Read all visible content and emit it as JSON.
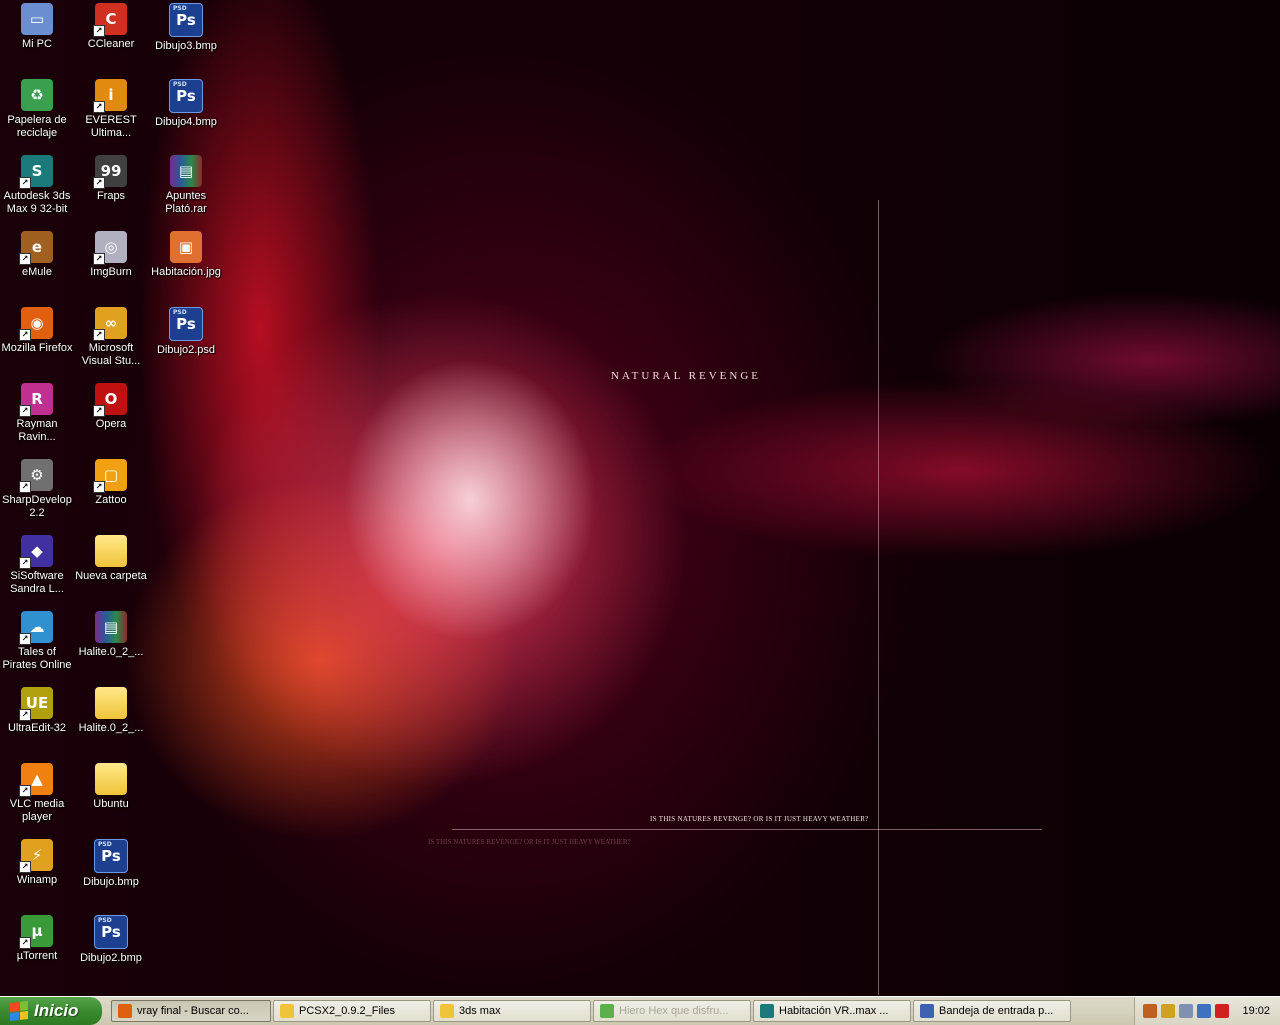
{
  "wallpaper": {
    "title": "NATURAL REVENGE",
    "caption": "IS THIS NATURES REVENGE? OR IS IT JUST HEAVY WEATHER?",
    "caption_ghost": "IS THIS NATURES REVENGE? OR IS IT JUST HEAVY WEATHER?"
  },
  "icons": [
    {
      "label": "Mi PC",
      "icon": "my-computer-icon",
      "glyph": "▭",
      "color": "#6a8ed0"
    },
    {
      "label": "CCleaner",
      "icon": "ccleaner-icon",
      "glyph": "C",
      "color": "#d03020",
      "shortcut": true
    },
    {
      "label": "Dibujo3.bmp",
      "icon": "photoshop-file-icon",
      "glyph": "Ps",
      "type": "psd"
    },
    {
      "label": "Papelera de reciclaje",
      "icon": "recycle-bin-icon",
      "glyph": "♻",
      "color": "#3aa050"
    },
    {
      "label": "EVEREST Ultima...",
      "icon": "everest-icon",
      "glyph": "i",
      "color": "#e08a10",
      "shortcut": true
    },
    {
      "label": "Dibujo4.bmp",
      "icon": "photoshop-file-icon",
      "glyph": "Ps",
      "type": "psd"
    },
    {
      "label": "Autodesk 3ds Max 9 32-bit",
      "icon": "3ds-max-icon",
      "glyph": "S",
      "color": "#1a7a7a",
      "shortcut": true
    },
    {
      "label": "Fraps",
      "icon": "fraps-icon",
      "glyph": "99",
      "color": "#404040",
      "shortcut": true
    },
    {
      "label": "Apuntes Plató.rar",
      "icon": "winrar-archive-icon",
      "glyph": "▤",
      "type": "rar"
    },
    {
      "label": "eMule",
      "icon": "emule-icon",
      "glyph": "e",
      "color": "#a06020",
      "shortcut": true
    },
    {
      "label": "ImgBurn",
      "icon": "imgburn-icon",
      "glyph": "◎",
      "color": "#b0b0c0",
      "shortcut": true
    },
    {
      "label": "Habitación.jpg",
      "icon": "image-file-icon",
      "glyph": "▣",
      "color": "#e07030"
    },
    {
      "label": "Mozilla Firefox",
      "icon": "firefox-icon",
      "glyph": "◉",
      "color": "#e06010",
      "shortcut": true
    },
    {
      "label": "Microsoft Visual Stu...",
      "icon": "visual-studio-icon",
      "glyph": "∞",
      "color": "#e0a020",
      "shortcut": true
    },
    {
      "label": "Dibujo2.psd",
      "icon": "photoshop-file-icon",
      "glyph": "Ps",
      "type": "psd"
    },
    {
      "label": "Rayman Ravin...",
      "icon": "rayman-icon",
      "glyph": "R",
      "color": "#c03090",
      "shortcut": true
    },
    {
      "label": "Opera",
      "icon": "opera-icon",
      "glyph": "O",
      "color": "#c01010",
      "shortcut": true
    },
    {
      "label": "SharpDevelop 2.2",
      "icon": "sharpdevelop-icon",
      "glyph": "⚙",
      "color": "#707070",
      "shortcut": true
    },
    {
      "label": "Zattoo",
      "icon": "zattoo-icon",
      "glyph": "▢",
      "color": "#f0a010",
      "shortcut": true
    },
    {
      "label": "SiSoftware Sandra L...",
      "icon": "sisoftware-icon",
      "glyph": "◆",
      "color": "#4030a0",
      "shortcut": true
    },
    {
      "label": "Nueva carpeta",
      "icon": "folder-icon",
      "glyph": "",
      "type": "folder"
    },
    {
      "label": "Tales of Pirates Online",
      "icon": "tales-of-pirates-icon",
      "glyph": "☁",
      "color": "#3090d0",
      "shortcut": true
    },
    {
      "label": "Halite.0_2_...",
      "icon": "winrar-archive-icon",
      "glyph": "▤",
      "type": "rar"
    },
    {
      "label": "UltraEdit-32",
      "icon": "ultraedit-icon",
      "glyph": "UE",
      "color": "#b0a010",
      "shortcut": true
    },
    {
      "label": "Halite.0_2_...",
      "icon": "folder-icon",
      "glyph": "",
      "type": "folder"
    },
    {
      "label": "VLC media player",
      "icon": "vlc-icon",
      "glyph": "▲",
      "color": "#f08010",
      "shortcut": true
    },
    {
      "label": "Ubuntu",
      "icon": "folder-icon",
      "glyph": "",
      "type": "folder"
    },
    {
      "label": "Winamp",
      "icon": "winamp-icon",
      "glyph": "⚡",
      "color": "#e0a020",
      "shortcut": true
    },
    {
      "label": "Dibujo.bmp",
      "icon": "photoshop-file-icon",
      "glyph": "Ps",
      "type": "psd"
    },
    {
      "label": "µTorrent",
      "icon": "utorrent-icon",
      "glyph": "µ",
      "color": "#3a9a3a",
      "shortcut": true
    },
    {
      "label": "Dibujo2.bmp",
      "icon": "photoshop-file-icon",
      "glyph": "Ps",
      "type": "psd"
    }
  ],
  "taskbar": {
    "start_label": "Inicio",
    "tasks": [
      {
        "label": "vray final - Buscar co...",
        "icon": "firefox-icon",
        "color": "#e06010",
        "active": true
      },
      {
        "label": "PCSX2_0.9.2_Files",
        "icon": "folder-icon",
        "color": "#f0c43a"
      },
      {
        "label": "3ds max",
        "icon": "folder-icon",
        "color": "#f0c43a"
      },
      {
        "label": "Hiero Hex que disfru...",
        "icon": "messenger-icon",
        "color": "#5ab04a",
        "faded": true
      },
      {
        "label": "Habitación VR..max   ...",
        "icon": "3ds-max-icon",
        "color": "#1a7a7a"
      },
      {
        "label": "Bandeja de entrada p...",
        "icon": "email-client-icon",
        "color": "#4060b0"
      }
    ],
    "tray_icons": [
      {
        "icon": "tray-app-icon",
        "color": "#c06020"
      },
      {
        "icon": "tray-pencil-icon",
        "color": "#d0a020"
      },
      {
        "icon": "tray-user-icon",
        "color": "#8090b0"
      },
      {
        "icon": "tray-network-icon",
        "color": "#4070c0"
      },
      {
        "icon": "tray-security-icon",
        "color": "#d02020"
      }
    ],
    "clock": "19:02"
  }
}
